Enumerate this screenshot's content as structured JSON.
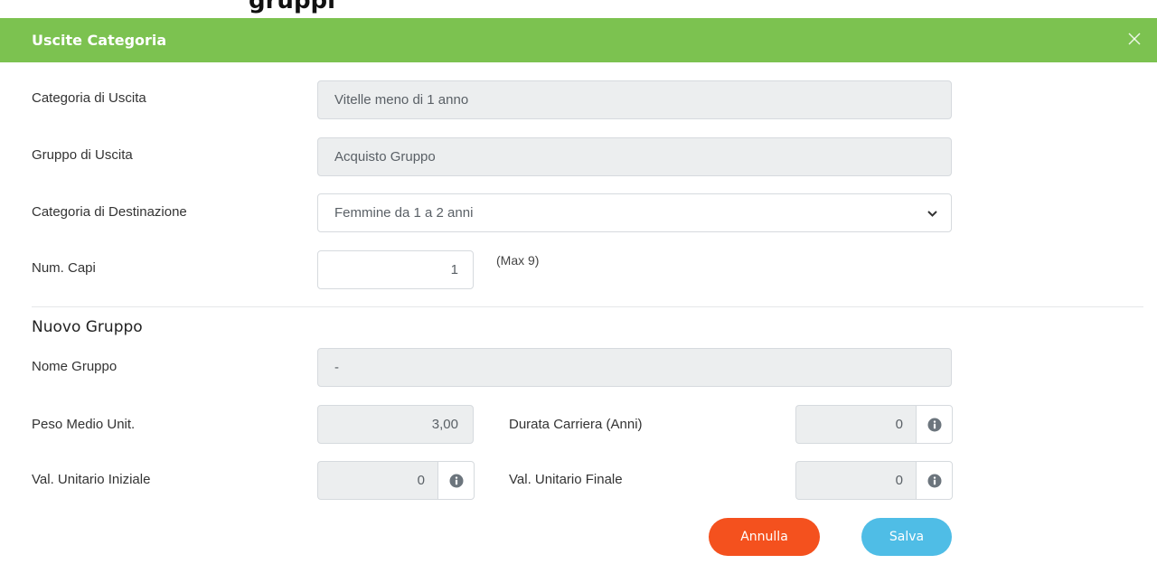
{
  "top_sliver_text": "gruppi",
  "modal": {
    "title": "Uscite Categoria",
    "close_glyph": "×"
  },
  "form": {
    "categoria_uscita": {
      "label": "Categoria di Uscita",
      "value": "Vitelle meno di 1 anno"
    },
    "gruppo_uscita": {
      "label": "Gruppo di Uscita",
      "value": "Acquisto Gruppo"
    },
    "categoria_destinazione": {
      "label": "Categoria di Destinazione",
      "value": "Femmine da 1 a 2 anni"
    },
    "num_capi": {
      "label": "Num. Capi",
      "value": "1",
      "hint": "(Max 9)"
    }
  },
  "nuovo_gruppo": {
    "title": "Nuovo Gruppo",
    "nome_gruppo": {
      "label": "Nome Gruppo",
      "value": "-"
    },
    "peso_medio": {
      "label": "Peso Medio Unit.",
      "value": "3,00"
    },
    "durata_carriera": {
      "label": "Durata Carriera (Anni)",
      "value": "0"
    },
    "val_iniziale": {
      "label": "Val. Unitario Iniziale",
      "value": "0"
    },
    "val_finale": {
      "label": "Val. Unitario Finale",
      "value": "0"
    }
  },
  "buttons": {
    "cancel": "Annulla",
    "save": "Salva"
  },
  "colors": {
    "header": "#7cc250",
    "cancel": "#f4511e",
    "save": "#4fbde6"
  },
  "icons": [
    "close-icon",
    "chevron-down-icon",
    "info-icon"
  ]
}
